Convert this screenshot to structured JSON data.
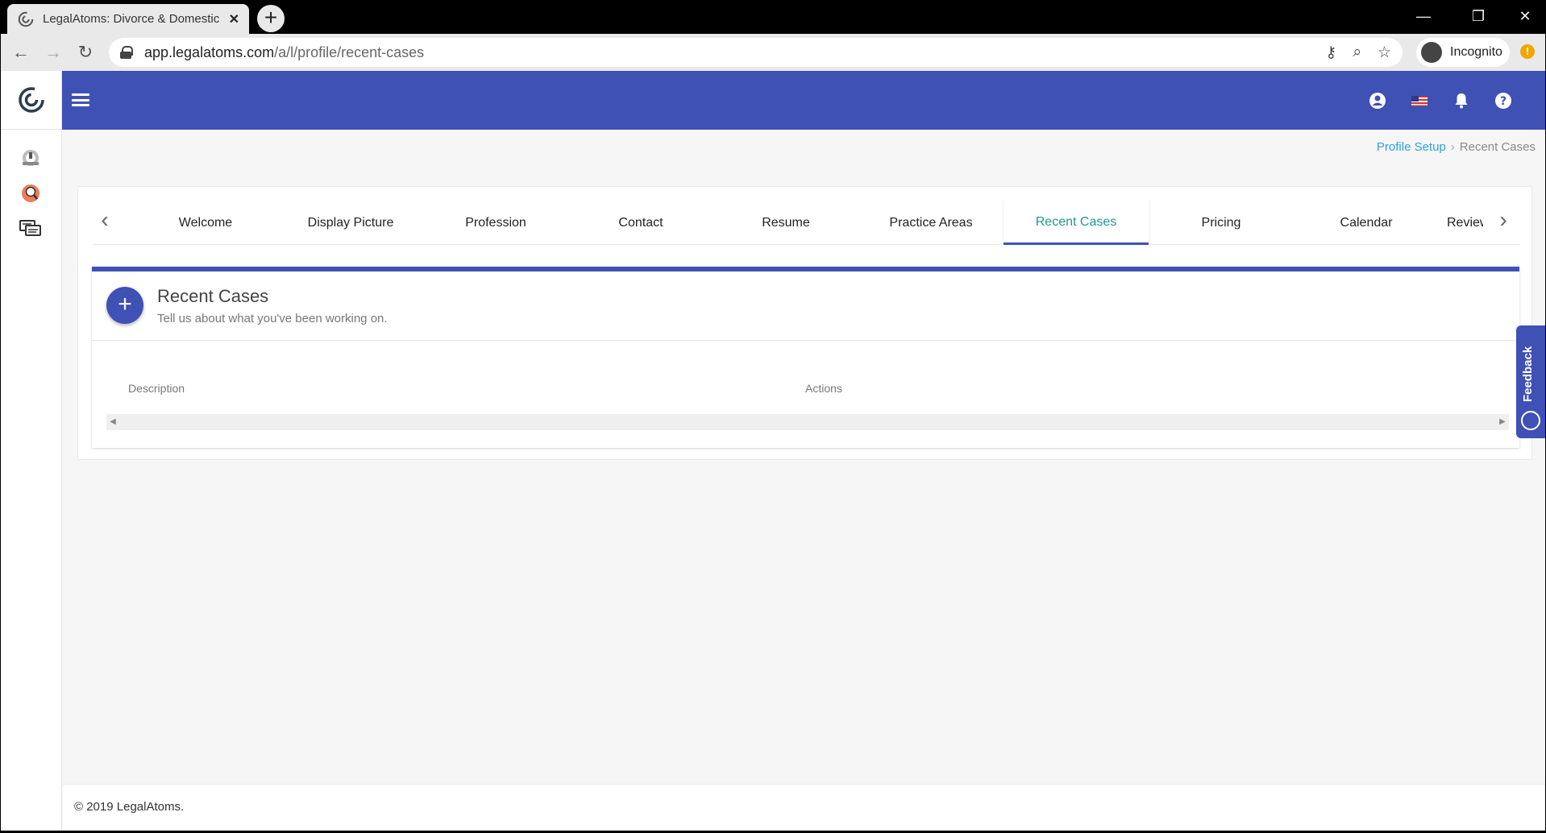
{
  "browser": {
    "tab_title": "LegalAtoms: Divorce & Domestic",
    "url_host": "app.legalatoms.com",
    "url_path": "/a/l/profile/recent-cases",
    "incognito_label": "Incognito"
  },
  "breadcrumb": {
    "parent": "Profile Setup",
    "current": "Recent Cases"
  },
  "profile_tabs": [
    {
      "label": "Welcome"
    },
    {
      "label": "Display Picture"
    },
    {
      "label": "Profession"
    },
    {
      "label": "Contact"
    },
    {
      "label": "Resume"
    },
    {
      "label": "Practice Areas"
    },
    {
      "label": "Recent Cases"
    },
    {
      "label": "Pricing"
    },
    {
      "label": "Calendar"
    },
    {
      "label": "Reviews"
    }
  ],
  "panel": {
    "title": "Recent Cases",
    "subtitle": "Tell us about what you've been working on.",
    "columns": {
      "description": "Description",
      "actions": "Actions"
    }
  },
  "feedback": {
    "label": "Feedback"
  },
  "footer": {
    "copyright": "© 2019 LegalAtoms."
  },
  "colors": {
    "primary": "#3f51b5",
    "active_tab_text": "#1e9b8c",
    "link": "#2ba3dc"
  }
}
